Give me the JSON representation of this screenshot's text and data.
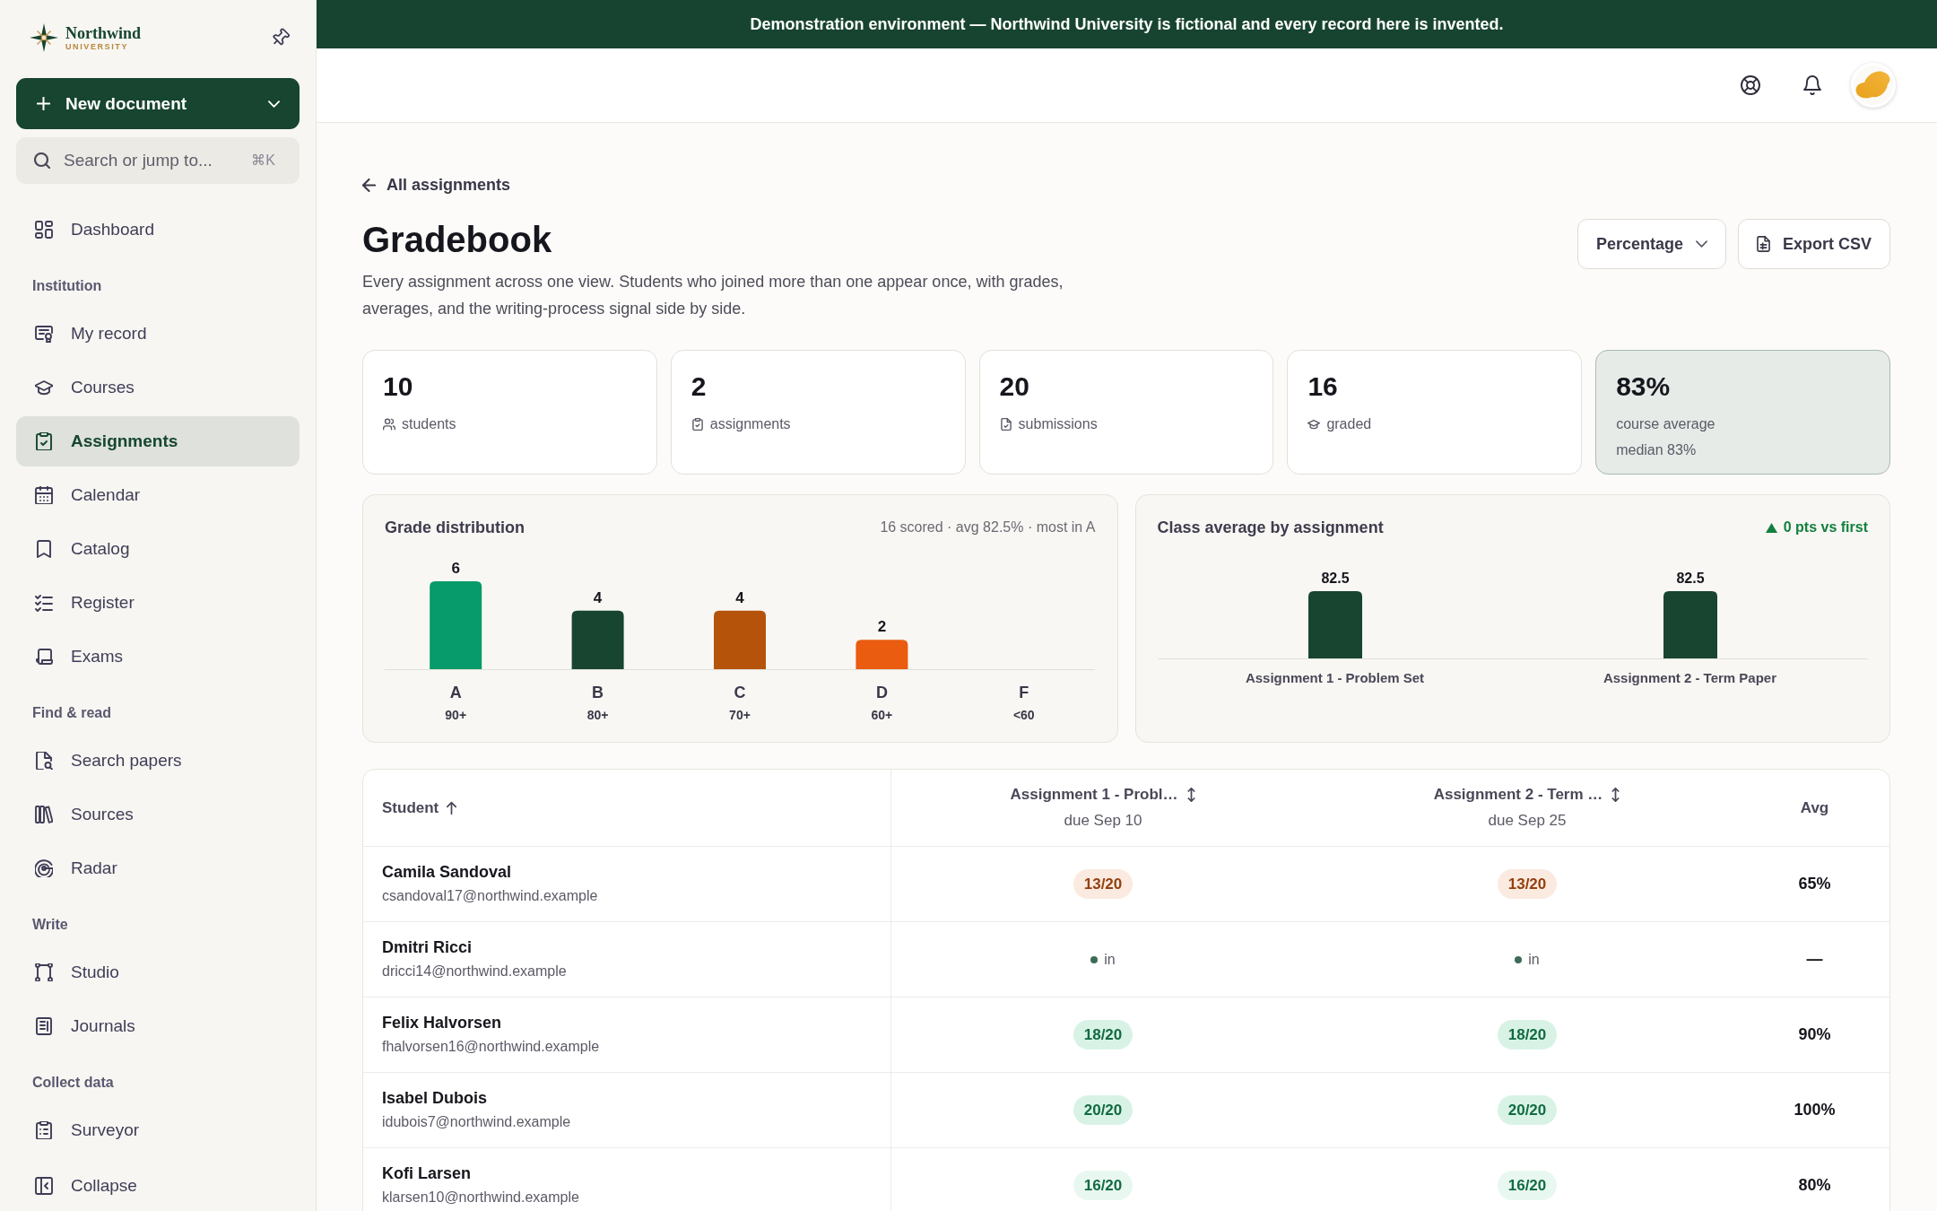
{
  "banner": {
    "text": "Demonstration environment — Northwind University is fictional and every record here is invented."
  },
  "sidebar": {
    "logo": {
      "name": "Northwind",
      "subtitle": "UNIVERSITY"
    },
    "new_button": {
      "label": "New document"
    },
    "search": {
      "placeholder": "Search or jump to...",
      "shortcut": "⌘K"
    },
    "groups": [
      {
        "items": [
          {
            "label": "Dashboard",
            "selected": false
          }
        ]
      },
      {
        "heading": "Institution",
        "items": [
          {
            "label": "My record",
            "selected": false
          },
          {
            "label": "Courses",
            "selected": false
          },
          {
            "label": "Assignments",
            "selected": true
          },
          {
            "label": "Calendar",
            "selected": false
          },
          {
            "label": "Catalog",
            "selected": false
          },
          {
            "label": "Register",
            "selected": false
          },
          {
            "label": "Exams",
            "selected": false
          }
        ]
      },
      {
        "heading": "Find & read",
        "items": [
          {
            "label": "Search papers",
            "selected": false
          },
          {
            "label": "Sources",
            "selected": false
          },
          {
            "label": "Radar",
            "selected": false
          }
        ]
      },
      {
        "heading": "Write",
        "items": [
          {
            "label": "Studio",
            "selected": false
          },
          {
            "label": "Journals",
            "selected": false
          }
        ]
      },
      {
        "heading": "Collect data",
        "items": [
          {
            "label": "Surveyor",
            "selected": false
          }
        ]
      }
    ],
    "collapse": {
      "label": "Collapse"
    }
  },
  "main": {
    "back_link": "All assignments",
    "title": "Gradebook",
    "description": "Every assignment across one view. Students who joined more than one appear once, with grades, averages, and the writing-process signal side by side.",
    "scale_select": {
      "value": "Percentage"
    },
    "export_button": {
      "label": "Export CSV"
    },
    "stats": [
      {
        "value": "10",
        "label": "students",
        "highlighted": false
      },
      {
        "value": "2",
        "label": "assignments",
        "highlighted": false
      },
      {
        "value": "20",
        "label": "submissions",
        "highlighted": false
      },
      {
        "value": "16",
        "label": "graded",
        "highlighted": false
      },
      {
        "value": "83%",
        "label": "course average",
        "note": "median 83%",
        "highlighted": true
      }
    ],
    "grade_distribution": {
      "title": "Grade distribution",
      "summary": "16 scored · avg 82.5% · most in A",
      "bands": [
        {
          "range": "90+",
          "color": "#079a6a"
        },
        {
          "range": "80+",
          "color": "#174530"
        },
        {
          "range": "70+",
          "color": "#b5530b"
        },
        {
          "range": "60+",
          "color": "#ea5c10"
        },
        {
          "range": "<60"
        }
      ],
      "chart_data": {
        "type": "bar",
        "categories": [
          "A",
          "B",
          "C",
          "D",
          "F"
        ],
        "values": [
          6,
          4,
          4,
          2,
          0
        ],
        "value_labels": [
          "6",
          "4",
          "4",
          "2",
          null
        ]
      }
    },
    "class_average": {
      "title": "Class average by assignment",
      "trend": {
        "text": "0 pts vs first",
        "rising": true
      },
      "chart_data": {
        "type": "bar",
        "categories": [
          "Assignment 1 - Problem Set",
          "Assignment 2 - Term Paper"
        ],
        "values": [
          82.5,
          82.5
        ],
        "value_labels": [
          "82.5",
          "82.5"
        ]
      }
    },
    "table": {
      "columns": [
        {
          "kind": "student",
          "label": "Student",
          "sortable": true,
          "sorted": true
        },
        {
          "kind": "assignment",
          "label": "Assignment 1 - Probl…",
          "due": "due Sep 10",
          "sortable": true,
          "sorted": false
        },
        {
          "kind": "assignment",
          "label": "Assignment 2 - Term …",
          "due": "due Sep 25",
          "sortable": true,
          "sorted": false
        },
        {
          "kind": "average",
          "label": "Avg",
          "sortable": false
        }
      ],
      "rows": [
        {
          "cells": [
            {
              "kind": "student",
              "name": "Camila Sandoval",
              "email": "csandoval17@northwind.example"
            },
            {
              "kind": "weak",
              "text": "13/20"
            },
            {
              "kind": "weak",
              "text": "13/20"
            },
            {
              "kind": "average",
              "text": "65%"
            }
          ]
        },
        {
          "cells": [
            {
              "kind": "student",
              "name": "Dmitri Ricci",
              "email": "dricci14@northwind.example"
            },
            {
              "kind": "submitted",
              "text": "in"
            },
            {
              "kind": "submitted",
              "text": "in"
            },
            {
              "kind": "average",
              "text": "—"
            }
          ]
        },
        {
          "cells": [
            {
              "kind": "student",
              "name": "Felix Halvorsen",
              "email": "fhalvorsen16@northwind.example"
            },
            {
              "kind": "top",
              "text": "18/20"
            },
            {
              "kind": "top",
              "text": "18/20"
            },
            {
              "kind": "average",
              "text": "90%"
            }
          ]
        },
        {
          "cells": [
            {
              "kind": "student",
              "name": "Isabel Dubois",
              "email": "idubois7@northwind.example"
            },
            {
              "kind": "top",
              "text": "20/20"
            },
            {
              "kind": "top",
              "text": "20/20"
            },
            {
              "kind": "average",
              "text": "100%"
            }
          ]
        },
        {
          "cells": [
            {
              "kind": "student",
              "name": "Kofi Larsen",
              "email": "klarsen10@northwind.example"
            },
            {
              "kind": "good",
              "text": "16/20"
            },
            {
              "kind": "good",
              "text": "16/20"
            },
            {
              "kind": "average",
              "text": "80%"
            }
          ]
        }
      ]
    }
  }
}
